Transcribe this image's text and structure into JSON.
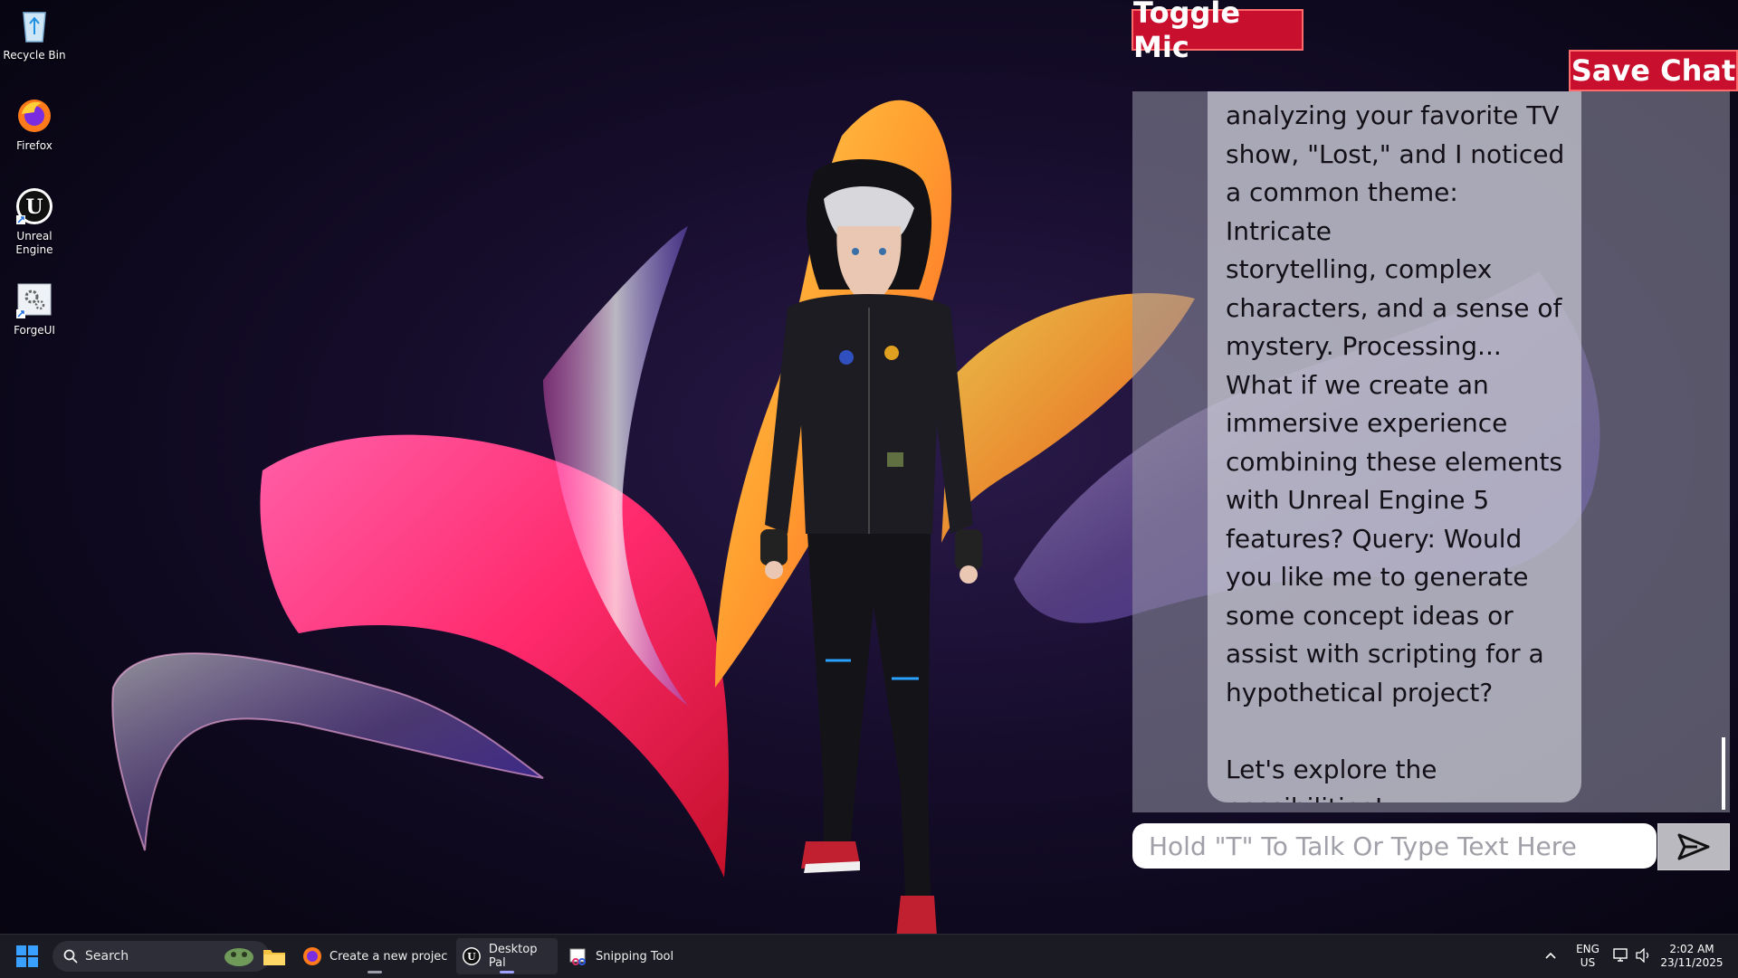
{
  "desktop": {
    "icons": [
      {
        "label": "Recycle Bin"
      },
      {
        "label": "Firefox"
      },
      {
        "label": "Unreal Engine"
      },
      {
        "label": "ForgeUI"
      }
    ]
  },
  "chat": {
    "toggle_mic_label": "Toggle Mic",
    "save_chat_label": "Save Chat",
    "message": "analyzing your favorite TV\nshow, \"Lost,\" and I noticed\na common theme: Intricate\nstorytelling, complex\ncharacters, and a sense of\nmystery. Processing...\nWhat if we create an\nimmersive experience\ncombining these elements\nwith Unreal Engine 5\nfeatures? Query: Would\nyou like me to generate\nsome concept ideas or\nassist with scripting for a\nhypothetical project?\n\nLet's explore the\npossibilities!",
    "input_placeholder": "Hold \"T\" To Talk Or Type Text Here",
    "input_value": ""
  },
  "taskbar": {
    "search_label": "Search",
    "apps": [
      {
        "label": "Create a new project - it"
      },
      {
        "label": "Desktop Pal"
      },
      {
        "label": "Snipping Tool"
      }
    ],
    "language": "ENG",
    "region": "US",
    "time": "2:02 AM",
    "date": "23/11/2025"
  },
  "colors": {
    "button_red": "#c8102e",
    "taskbar": "#1b1b23"
  }
}
